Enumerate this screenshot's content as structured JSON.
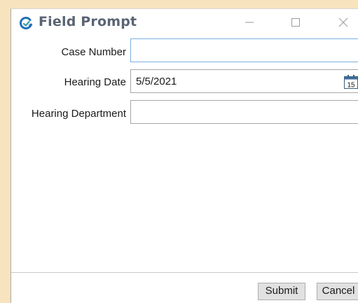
{
  "window": {
    "title": "Field Prompt",
    "icon": "refresh-cycle-icon",
    "controls": [
      "minimize-icon",
      "maximize-icon",
      "close-icon"
    ]
  },
  "form": {
    "case_number": {
      "label": "Case Number",
      "value": ""
    },
    "hearing_date": {
      "label": "Hearing Date",
      "value": "5/5/2021",
      "calendar_day": "15",
      "calendar_icon": "calendar-icon"
    },
    "hearing_department": {
      "label": "Hearing Department",
      "value": ""
    }
  },
  "buttons": {
    "submit": "Submit",
    "cancel": "Cancel"
  },
  "colors": {
    "background": "#f7e4bf",
    "title_text": "#5a6472",
    "icon_accent": "#1f6fb8",
    "focus_border": "#7ab0e0"
  }
}
